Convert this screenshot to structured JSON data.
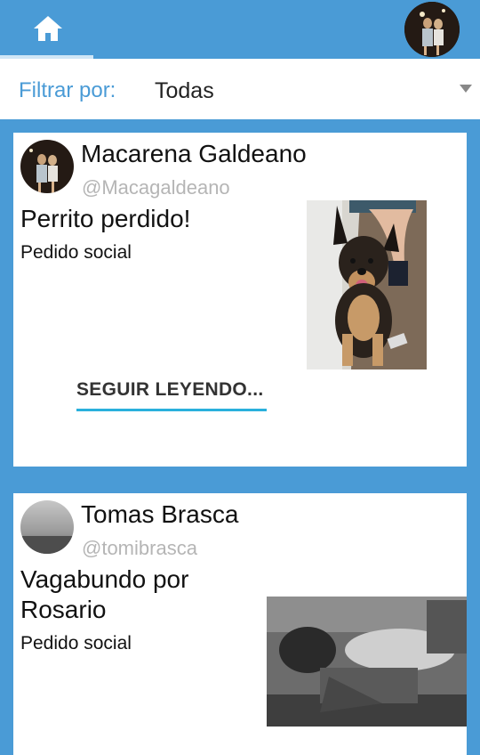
{
  "nav": {
    "home_icon": "home-icon",
    "user_avatar": "user-avatar"
  },
  "filter": {
    "label": "Filtrar por:",
    "selected": "Todas"
  },
  "posts": [
    {
      "author": "Macarena Galdeano",
      "handle": "@Macagaldeano",
      "title": "Perrito perdido!",
      "category": "Pedido social",
      "read_more": "SEGUIR LEYENDO..."
    },
    {
      "author": "Tomas Brasca",
      "handle": "@tomibrasca",
      "title": "Vagabundo por Rosario",
      "category": "Pedido social"
    }
  ],
  "colors": {
    "primary": "#4a9bd6",
    "accent_underline": "#2ab0dc",
    "handle_gray": "#b5b5b5"
  }
}
